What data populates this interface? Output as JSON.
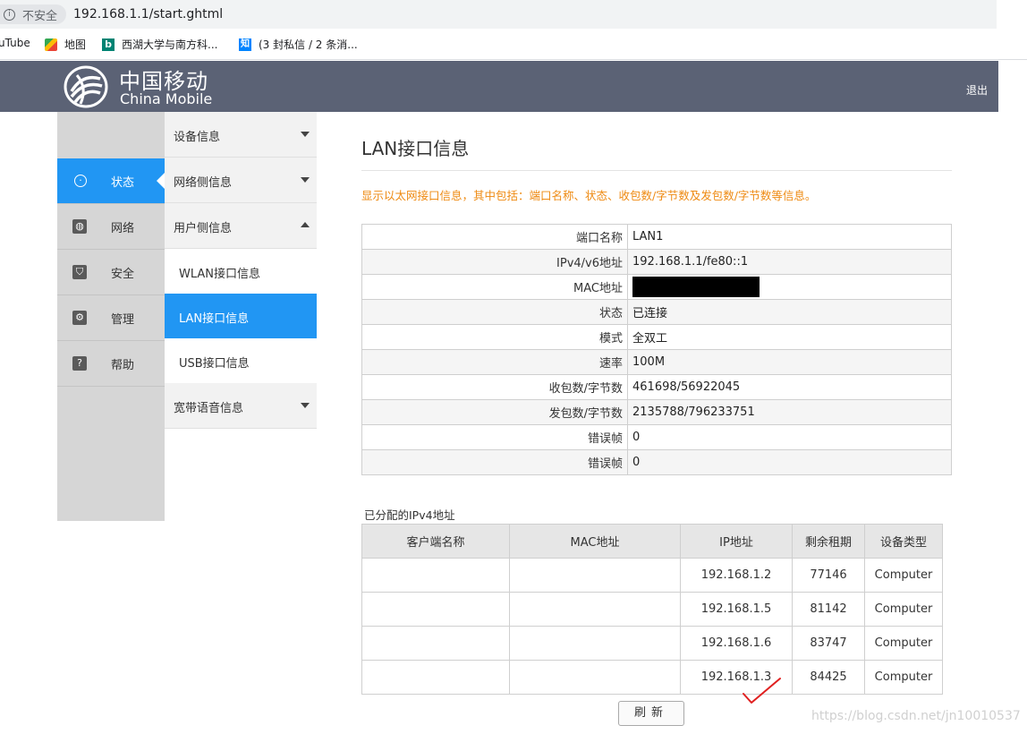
{
  "browser": {
    "security_label": "不安全",
    "url": "192.168.1.1/start.ghtml",
    "bookmarks": [
      {
        "label": "uTube"
      },
      {
        "label": "地图"
      },
      {
        "label": "西湖大学与南方科..."
      },
      {
        "label": "(3 封私信 / 2 条消..."
      }
    ]
  },
  "header": {
    "logo_cn": "中国移动",
    "logo_en": "China Mobile",
    "logout": "退出"
  },
  "leftnav": {
    "items": [
      {
        "label": "状态",
        "icon": "target-icon",
        "active": true
      },
      {
        "label": "网络",
        "icon": "globe-icon"
      },
      {
        "label": "安全",
        "icon": "shield-icon"
      },
      {
        "label": "管理",
        "icon": "gear-icon"
      },
      {
        "label": "帮助",
        "icon": "help-icon"
      }
    ]
  },
  "subnav": {
    "device_info": "设备信息",
    "network_side": "网络侧信息",
    "user_side": "用户侧信息",
    "wlan": "WLAN接口信息",
    "lan": "LAN接口信息",
    "usb": "USB接口信息",
    "voice": "宽带语音信息"
  },
  "main": {
    "title": "LAN接口信息",
    "description": "显示以太网接口信息，其中包括：端口名称、状态、收包数/字节数及发包数/字节数等信息。",
    "info_rows": [
      {
        "key": "端口名称",
        "value": "LAN1"
      },
      {
        "key": "IPv4/v6地址",
        "value": "192.168.1.1/fe80::1"
      },
      {
        "key": "MAC地址",
        "value": ""
      },
      {
        "key": "状态",
        "value": "已连接"
      },
      {
        "key": "模式",
        "value": "全双工"
      },
      {
        "key": "速率",
        "value": "100M"
      },
      {
        "key": "收包数/字节数",
        "value": "461698/56922045"
      },
      {
        "key": "发包数/字节数",
        "value": "2135788/796233751"
      },
      {
        "key": "错误帧",
        "value": "0"
      },
      {
        "key": "错误帧",
        "value": "0"
      }
    ],
    "assigned_title": "已分配的IPv4地址",
    "clients_headers": [
      "客户端名称",
      "MAC地址",
      "IP地址",
      "剩余租期",
      "设备类型"
    ],
    "clients": [
      {
        "name": "",
        "mac": "",
        "ip": "192.168.1.2",
        "lease": "77146",
        "type": "Computer"
      },
      {
        "name": "",
        "mac": "",
        "ip": "192.168.1.5",
        "lease": "81142",
        "type": "Computer"
      },
      {
        "name": "",
        "mac": "",
        "ip": "192.168.1.6",
        "lease": "83747",
        "type": "Computer"
      },
      {
        "name": "",
        "mac": "",
        "ip": "192.168.1.3",
        "lease": "84425",
        "type": "Computer"
      }
    ],
    "refresh": "刷新"
  },
  "watermark": "https://blog.csdn.net/jn10010537",
  "colors": {
    "header_bg": "#5b6275",
    "accent": "#2196f3",
    "desc": "#ee8a12",
    "annotation": "#e02020"
  }
}
